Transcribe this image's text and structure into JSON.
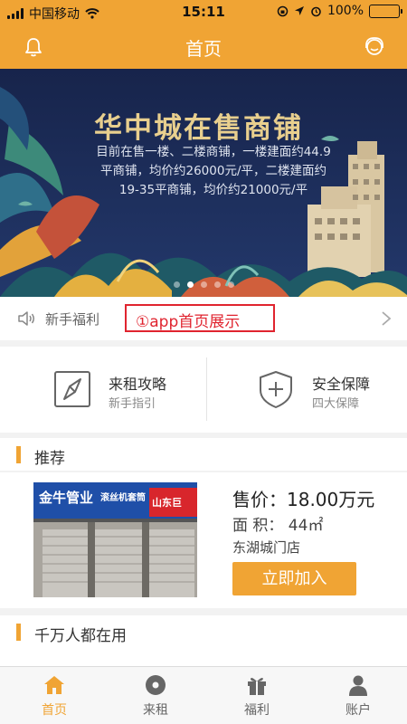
{
  "status_bar": {
    "carrier": "中国移动",
    "time": "15:11",
    "battery": "100%"
  },
  "nav": {
    "title": "首页"
  },
  "banner": {
    "headline": "华中城在售商铺",
    "subtitle": "目前在售一楼、二楼商铺，一楼建面约44.9平商铺，均价约26000元/平，二楼建面约19-35平商铺，均价约21000元/平",
    "active_slide": 1,
    "slide_count": 5
  },
  "notice": {
    "label": "新手福利",
    "highlight": "①app首页展示"
  },
  "quick_links": [
    {
      "title": "来租攻略",
      "subtitle": "新手指引",
      "icon": "compass-icon"
    },
    {
      "title": "安全保障",
      "subtitle": "四大保障",
      "icon": "shield-plus-icon"
    }
  ],
  "sections": {
    "recommend": "推荐",
    "popular": "千万人都在用"
  },
  "recommend_item": {
    "price": "售价：18.00万元",
    "area": "面  积：  44㎡",
    "location": "东湖城门店",
    "button": "立即加入",
    "sign_text": "金牛管业",
    "sign_text2": "滚丝机套筒",
    "sign_text3": "山东巨"
  },
  "tabs": [
    {
      "label": "首页",
      "icon": "home-icon",
      "active": true
    },
    {
      "label": "来租",
      "icon": "compass-dot-icon",
      "active": false
    },
    {
      "label": "福利",
      "icon": "gift-icon",
      "active": false
    },
    {
      "label": "账户",
      "icon": "user-icon",
      "active": false
    }
  ],
  "colors": {
    "accent": "#f0a434",
    "highlight_red": "#e0242f",
    "banner_navy": "#1a2a55"
  }
}
